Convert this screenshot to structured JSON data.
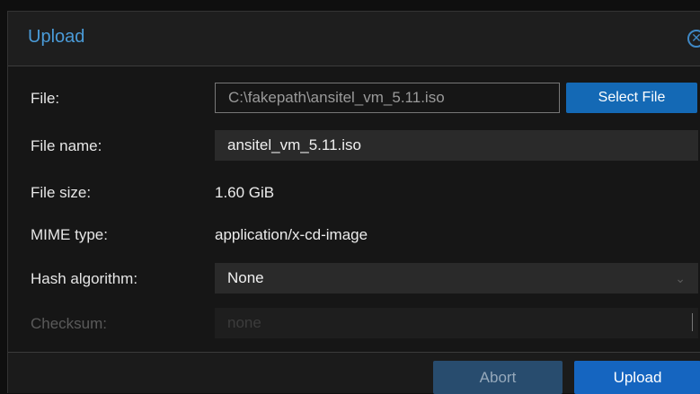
{
  "dialog": {
    "title": "Upload"
  },
  "form": {
    "file_label": "File:",
    "file_value": "C:\\fakepath\\ansitel_vm_5.11.iso",
    "select_file_label": "Select File",
    "file_name_label": "File name:",
    "file_name_value": "ansitel_vm_5.11.iso",
    "file_size_label": "File size:",
    "file_size_value": "1.60 GiB",
    "mime_type_label": "MIME type:",
    "mime_type_value": "application/x-cd-image",
    "hash_algorithm_label": "Hash algorithm:",
    "hash_algorithm_value": "None",
    "checksum_label": "Checksum:",
    "checksum_placeholder": "none"
  },
  "footer": {
    "abort_label": "Abort",
    "upload_label": "Upload"
  },
  "colors": {
    "accent": "#4a9bd8",
    "primary_button": "#1565c0",
    "disabled_button": "#284c6e"
  },
  "icons": {
    "close": "close-circle-icon",
    "dropdown": "chevron-down-icon"
  }
}
